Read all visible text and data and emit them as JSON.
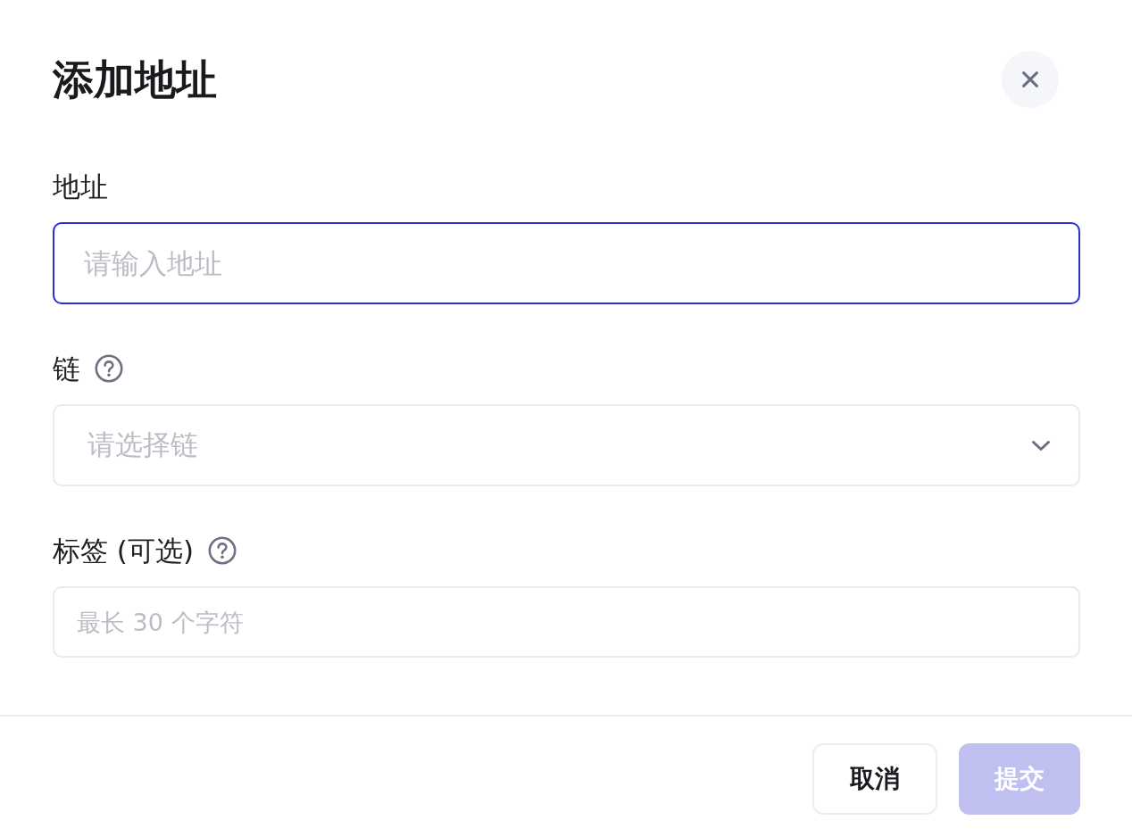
{
  "dialog": {
    "title": "添加地址"
  },
  "fields": [
    {
      "kind": "text",
      "label": "地址",
      "help": false,
      "placeholder": "请输入地址",
      "focused": true
    },
    {
      "kind": "select",
      "label": "链",
      "help": true,
      "placeholder": "请选择链",
      "focused": false
    },
    {
      "kind": "text",
      "label": "标签 (可选)",
      "help": true,
      "placeholder": "最长 30 个字符",
      "focused": false
    }
  ],
  "buttons": [
    {
      "kind": "secondary",
      "label": "取消",
      "disabled": false
    },
    {
      "kind": "primary",
      "label": "提交",
      "disabled": true
    }
  ]
}
